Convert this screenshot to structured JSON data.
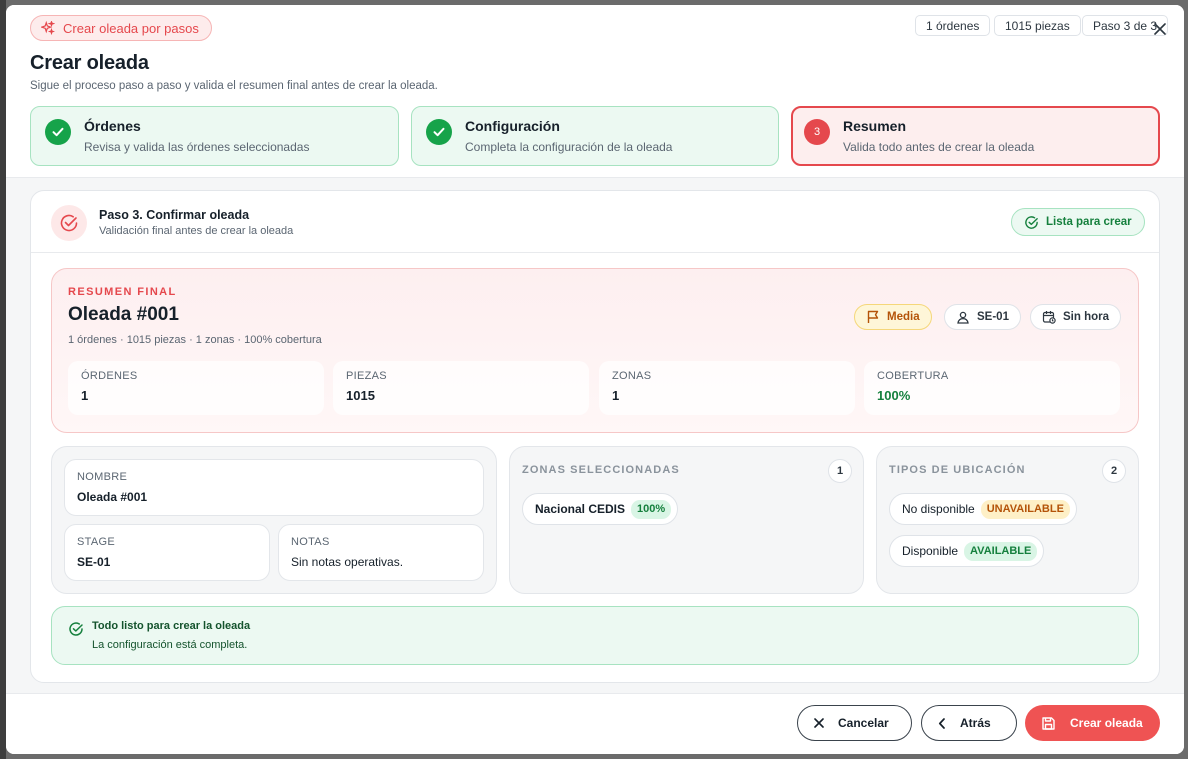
{
  "header": {
    "badge_label": "Crear oleada por pasos",
    "stats": [
      "1 órdenes",
      "1015 piezas",
      "Paso 3 de 3"
    ],
    "title": "Crear oleada",
    "subtitle": "Sigue el proceso paso a paso y valida el resumen final antes de crear la oleada."
  },
  "steps": [
    {
      "title": "Órdenes",
      "desc": "Revisa y valida las órdenes seleccionadas",
      "status": "done"
    },
    {
      "title": "Configuración",
      "desc": "Completa la configuración de la oleada",
      "status": "done"
    },
    {
      "title": "Resumen",
      "desc": "Valida todo antes de crear la oleada",
      "status": "active",
      "number": "3"
    }
  ],
  "confirm": {
    "title": "Paso 3. Confirmar oleada",
    "subtitle": "Validación final antes de crear la oleada",
    "ready_label": "Lista para crear"
  },
  "summary": {
    "kicker": "RESUMEN FINAL",
    "title": "Oleada #001",
    "meta": "1 órdenes · 1015 piezas · 1 zonas · 100% cobertura",
    "priority": "Media",
    "stage": "SE-01",
    "time": "Sin hora",
    "metrics": [
      {
        "label": "ÓRDENES",
        "value": "1"
      },
      {
        "label": "PIEZAS",
        "value": "1015"
      },
      {
        "label": "ZONAS",
        "value": "1"
      },
      {
        "label": "COBERTURA",
        "value": "100%"
      }
    ]
  },
  "details": {
    "name_label": "NOMBRE",
    "name_value": "Oleada #001",
    "stage_label": "STAGE",
    "stage_value": "SE-01",
    "notes_label": "NOTAS",
    "notes_value": "Sin notas operativas."
  },
  "zones": {
    "title": "ZONAS SELECCIONADAS",
    "count": "1",
    "items": [
      {
        "name": "Nacional CEDIS",
        "pct": "100%"
      }
    ]
  },
  "location_types": {
    "title": "TIPOS DE UBICACIÓN",
    "count": "2",
    "items": [
      {
        "name": "No disponible",
        "code": "UNAVAILABLE"
      },
      {
        "name": "Disponible",
        "code": "AVAILABLE"
      }
    ]
  },
  "ready_box": {
    "title": "Todo listo para crear la oleada",
    "subtitle": "La configuración está completa."
  },
  "footer": {
    "cancel": "Cancelar",
    "back": "Atrás",
    "create": "Crear oleada"
  },
  "colors": {
    "accent": "#ef5353",
    "success": "#16a34a",
    "warning": "#b45309"
  }
}
